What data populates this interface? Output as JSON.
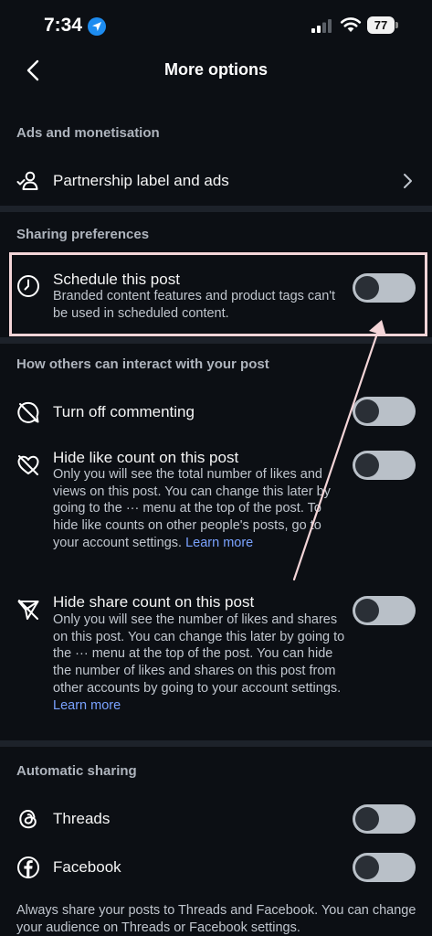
{
  "status": {
    "time": "7:34",
    "battery": "77"
  },
  "header": {
    "title": "More options"
  },
  "sections": {
    "ads": "Ads and monetisation",
    "sharing": "Sharing preferences",
    "interact": "How others can interact with your post",
    "auto": "Automatic sharing"
  },
  "rows": {
    "partnership": {
      "title": "Partnership label and ads"
    },
    "schedule": {
      "title": "Schedule this post",
      "desc": "Branded content features and product tags can't be used in scheduled content.",
      "enabled": false
    },
    "commenting": {
      "title": "Turn off commenting",
      "enabled": false
    },
    "like_count": {
      "title": "Hide like count on this post",
      "desc": "Only you will see the total number of likes and views on this post. You can change this later by going to the ··· menu at the top of the post. To hide like counts on other people's posts, go to your account settings.",
      "link": "Learn more",
      "enabled": false
    },
    "share_count": {
      "title": "Hide share count on this post",
      "desc": "Only you will see the number of likes and shares on this post. You can change this later by going to the ··· menu at the top of the post. You can hide the number of likes and shares on this post from other accounts by going to your account settings.",
      "link": "Learn more",
      "enabled": false
    },
    "threads": {
      "title": "Threads",
      "enabled": false
    },
    "facebook": {
      "title": "Facebook",
      "enabled": false
    }
  },
  "footer": "Always share your posts to Threads and Facebook. You can change your audience on Threads or Facebook settings.",
  "colors": {
    "background": "#0c0f14",
    "toggle_off": "#b9c0c8",
    "link": "#7aa2ff",
    "highlight": "#f4d5d8",
    "location_badge": "#1d8cf0"
  },
  "icons": {
    "back": "chevron-left-icon",
    "partnership": "user-check-icon",
    "schedule": "clock-icon",
    "commenting": "comment-off-icon",
    "like_count": "heart-off-icon",
    "share_count": "share-off-icon",
    "threads": "threads-icon",
    "facebook": "facebook-icon"
  }
}
